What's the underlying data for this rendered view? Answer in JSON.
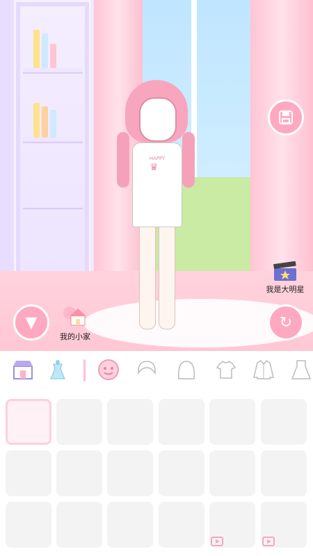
{
  "scene": {
    "home_label": "我的小家",
    "star_label": "我是大明星",
    "shirt_text": "HAPPY"
  },
  "tabs": [
    {
      "name": "shop",
      "icon": "shop-icon"
    },
    {
      "name": "dress-preset",
      "icon": "dress-stand-icon"
    },
    {
      "name": "face",
      "icon": "face-icon",
      "active": true
    },
    {
      "name": "hair-short",
      "icon": "hair-short-icon"
    },
    {
      "name": "hair-long",
      "icon": "hair-long-icon"
    },
    {
      "name": "tshirt",
      "icon": "tshirt-icon"
    },
    {
      "name": "shirt",
      "icon": "shirt-icon"
    },
    {
      "name": "dress",
      "icon": "dress-icon"
    }
  ],
  "grid": {
    "rows": 3,
    "cols": 6,
    "selected_index": 0,
    "video_locked_indices": [
      16,
      17
    ]
  },
  "colors": {
    "accent": "#ffa9c1",
    "accent_light": "#ffcfe0"
  }
}
